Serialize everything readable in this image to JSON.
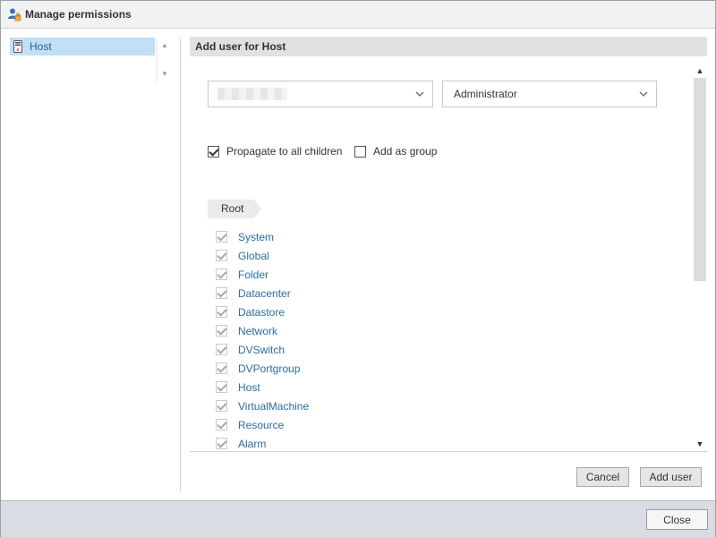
{
  "dialog": {
    "title": "Manage permissions",
    "title_icon": "users-permissions-icon"
  },
  "tree": {
    "items": [
      {
        "label": "Host",
        "icon": "host-icon",
        "selected": true
      }
    ]
  },
  "panel": {
    "header": "Add user for Host",
    "user_select": {
      "value": "",
      "redacted": true
    },
    "role_select": {
      "value": "Administrator"
    },
    "propagate": {
      "label": "Propagate to all children",
      "checked": true
    },
    "add_as_group": {
      "label": "Add as group",
      "checked": false
    },
    "breadcrumb": "Root",
    "privileges": [
      {
        "label": "System",
        "checked": true
      },
      {
        "label": "Global",
        "checked": true
      },
      {
        "label": "Folder",
        "checked": true
      },
      {
        "label": "Datacenter",
        "checked": true
      },
      {
        "label": "Datastore",
        "checked": true
      },
      {
        "label": "Network",
        "checked": true
      },
      {
        "label": "DVSwitch",
        "checked": true
      },
      {
        "label": "DVPortgroup",
        "checked": true
      },
      {
        "label": "Host",
        "checked": true
      },
      {
        "label": "VirtualMachine",
        "checked": true
      },
      {
        "label": "Resource",
        "checked": true
      },
      {
        "label": "Alarm",
        "checked": true
      }
    ],
    "cancel_label": "Cancel",
    "add_user_label": "Add user"
  },
  "footer": {
    "close_label": "Close"
  },
  "colors": {
    "selected_bg": "#bfe0f7",
    "link": "#2b6ca3",
    "footer_bg": "#d9dde3",
    "header_bg": "#e1e1e1"
  }
}
